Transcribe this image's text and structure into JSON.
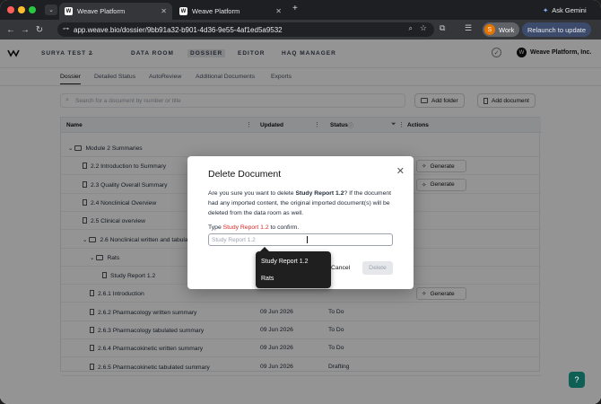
{
  "browser": {
    "tabs": [
      {
        "title": "Weave Platform",
        "favicon": "W"
      },
      {
        "title": "Weave Platform",
        "favicon": "W"
      }
    ],
    "new_tab": "+",
    "ask_gemini": "Ask Gemini",
    "url": "app.weave.bio/dossier/9bb91a32-b901-4d36-9e55-4af1ed5a9532",
    "profile_initial": "S",
    "profile_label": "Work",
    "relaunch_label": "Relaunch to update"
  },
  "app": {
    "project": "SURYA TEST 2",
    "nav": [
      "DATA ROOM",
      "DOSSIER",
      "EDITOR",
      "HAQ MANAGER"
    ],
    "active_nav": "DOSSIER",
    "org": "Weave Platform, Inc.",
    "subtabs": [
      "Dossier",
      "Detailed Status",
      "AutoReview",
      "Additional Documents",
      "Exports"
    ],
    "search_placeholder": "Search for a document by number or title",
    "add_folder": "Add folder",
    "add_document": "Add document",
    "columns": {
      "name": "Name",
      "updated": "Updated",
      "status": "Status",
      "actions": "Actions"
    },
    "rows": [
      {
        "name": "Module 2 Summaries",
        "type": "folder",
        "indent": 0,
        "date": "",
        "status": "",
        "generate": false
      },
      {
        "name": "2.2 Introduction to Summary",
        "type": "file",
        "indent": 1,
        "date": "",
        "status": "",
        "generate": true
      },
      {
        "name": "2.3 Quality Overall Summary",
        "type": "file",
        "indent": 1,
        "date": "",
        "status": "",
        "generate": true
      },
      {
        "name": "2.4 Nonclinical Overview",
        "type": "file",
        "indent": 1,
        "date": "",
        "status": "",
        "generate": false
      },
      {
        "name": "2.5 Clinical overview",
        "type": "file",
        "indent": 1,
        "date": "",
        "status": "",
        "generate": false
      },
      {
        "name": "2.6 Nonclinical written and tabula",
        "type": "folder",
        "indent": 1,
        "date": "",
        "status": "",
        "generate": false
      },
      {
        "name": "Rats",
        "type": "folder",
        "indent": 2,
        "date": "",
        "status": "",
        "generate": false
      },
      {
        "name": "Study Report 1.2",
        "type": "file",
        "indent": 3,
        "date": "",
        "status": "",
        "generate": false
      },
      {
        "name": "2.6.1 Introduction",
        "type": "file",
        "indent": 2,
        "date": "",
        "status": "",
        "generate": true
      },
      {
        "name": "2.6.2 Pharmacology written summary",
        "type": "file",
        "indent": 2,
        "date": "09 Jun 2026",
        "status": "To Do",
        "generate": false
      },
      {
        "name": "2.6.3 Pharmacology tabulated summary",
        "type": "file",
        "indent": 2,
        "date": "09 Jun 2026",
        "status": "To Do",
        "generate": false
      },
      {
        "name": "2.6.4 Pharmacokinetic written summary",
        "type": "file",
        "indent": 2,
        "date": "09 Jun 2026",
        "status": "To Do",
        "generate": false
      },
      {
        "name": "2.6.5 Pharmacokinetic tabulated summary",
        "type": "file",
        "indent": 2,
        "date": "09 Jun 2026",
        "status": "Drafting",
        "generate": false
      }
    ],
    "generate_label": "Generate"
  },
  "modal": {
    "title": "Delete Document",
    "body_pre": "Are you sure you want to delete ",
    "body_name": "Study Report 1.2",
    "body_post": "? If the document had any imported content, the original imported document(s) will be deleted from the data room as well.",
    "prompt_pre": "Type ",
    "prompt_name": "Study Report 1.2",
    "prompt_post": " to confirm.",
    "input_placeholder": "Study Report 1.2",
    "cancel": "Cancel",
    "delete": "Delete"
  },
  "dropdown": {
    "items": [
      "Study Report 1.2",
      "Rats"
    ]
  },
  "help_label": "?"
}
